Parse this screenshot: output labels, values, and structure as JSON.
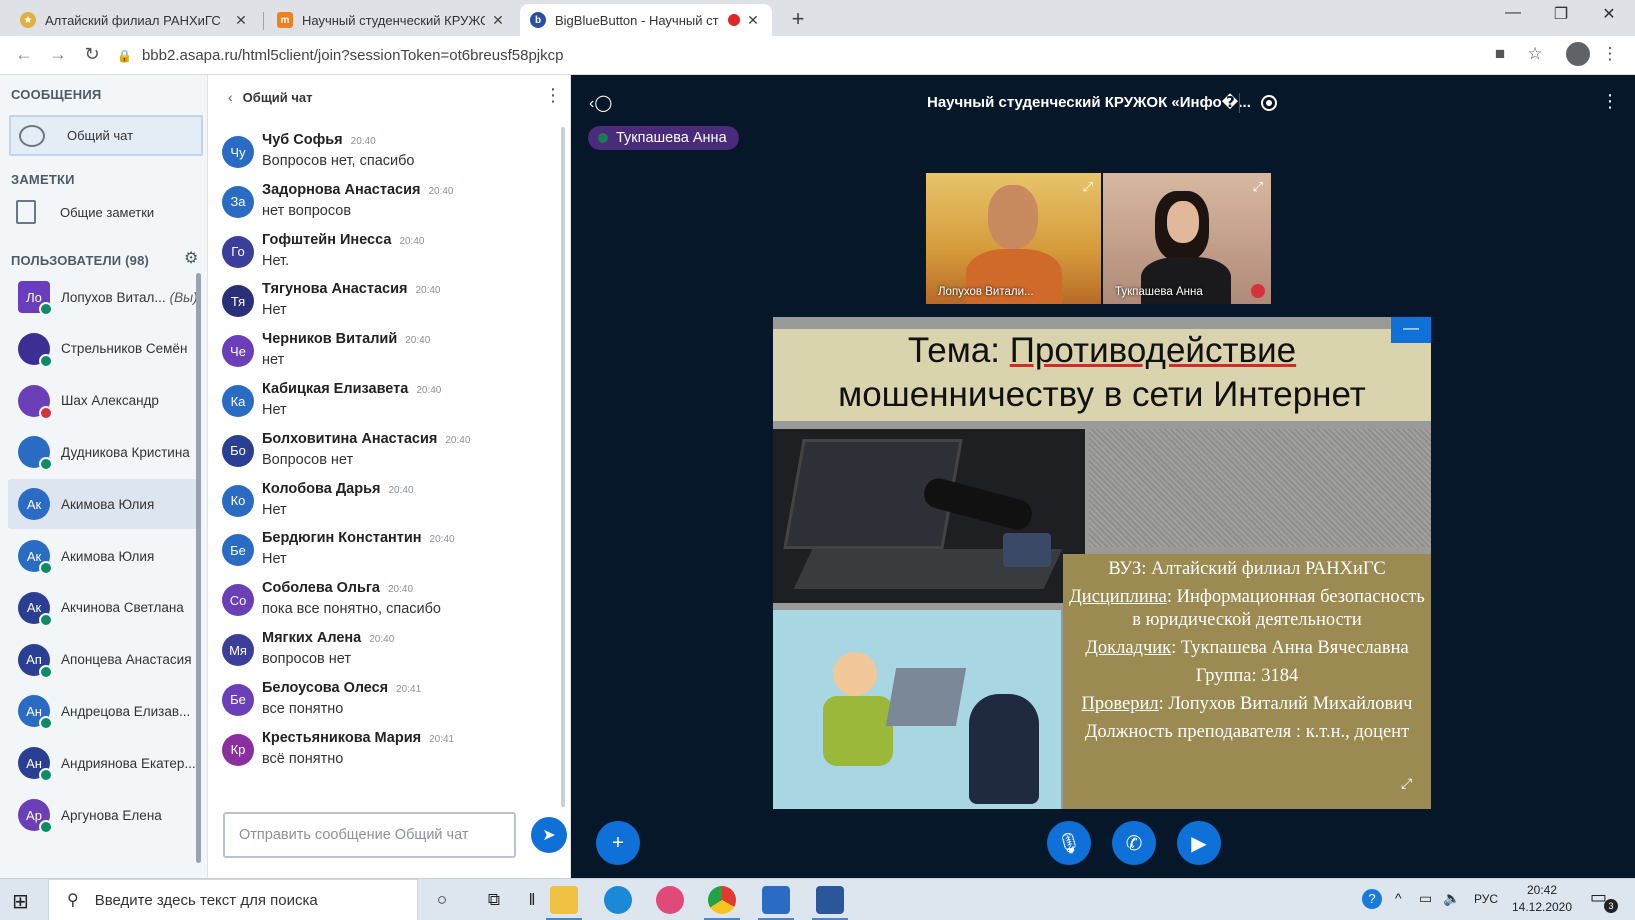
{
  "browser": {
    "tabs": [
      {
        "title": "Алтайский филиал РАНХиГС",
        "favicon": "ranepa-icon"
      },
      {
        "title": "Научный студенческий КРУЖО",
        "favicon": "moodle-icon"
      },
      {
        "title": "BigBlueButton - Научный ст",
        "favicon": "bbb-icon",
        "active": true,
        "recording": true
      }
    ],
    "new_tab": "+",
    "url": "bbb2.asapa.ru/html5client/join?sessionToken=ot6breusf58pjkcp"
  },
  "left": {
    "messages_title": "СООБЩЕНИЯ",
    "public_chat": "Общий чат",
    "notes_title": "ЗАМЕТКИ",
    "shared_notes": "Общие заметки",
    "users_title": "ПОЛЬЗОВАТЕЛИ (98)",
    "users": [
      {
        "initials": "Ло",
        "name": "Лопухов Витал...",
        "you": "(Вы)",
        "color": "#6a3dbe",
        "presenter": true,
        "badge": "mic"
      },
      {
        "initials": "",
        "name": "Стрельников Семён",
        "color": "#3b2f93",
        "badge": "mic"
      },
      {
        "initials": "",
        "name": "Шах Александр",
        "color": "#6b3fb8",
        "badge": "muted"
      },
      {
        "initials": "",
        "name": "Дудникова Кристина",
        "color": "#2a6cc3",
        "badge": "mic"
      },
      {
        "initials": "Ак",
        "name": "Акимова Юлия",
        "color": "#2a6cc3",
        "badge": "none",
        "highlight": true
      },
      {
        "initials": "Ак",
        "name": "Акимова Юлия",
        "color": "#2a6cc3",
        "badge": "mic"
      },
      {
        "initials": "Ак",
        "name": "Акчинова Светлана",
        "color": "#2a3f93",
        "badge": "mic"
      },
      {
        "initials": "Ап",
        "name": "Апонцева Анастасия",
        "color": "#2a3f93",
        "badge": "mic"
      },
      {
        "initials": "Ан",
        "name": "Андрецова Елизав...",
        "color": "#2a6cc3",
        "badge": "mic"
      },
      {
        "initials": "Ан",
        "name": "Андриянова Екатер...",
        "color": "#2a3f93",
        "badge": "mic"
      },
      {
        "initials": "Ар",
        "name": "Аргунова Елена",
        "color": "#6b3fb8",
        "badge": "mic"
      }
    ]
  },
  "chat": {
    "title": "Общий чат",
    "messages": [
      {
        "initials": "Чу",
        "name": "Чуб Софья",
        "time": "20:40",
        "text": "Вопросов нет, спасибо",
        "color": "#2a6cc3"
      },
      {
        "initials": "За",
        "name": "Задорнова Анастасия",
        "time": "20:40",
        "text": "нет вопросов",
        "color": "#2a6cc3"
      },
      {
        "initials": "Го",
        "name": "Гофштейн Инесса",
        "time": "20:40",
        "text": "Нет.",
        "color": "#3b3f9a"
      },
      {
        "initials": "Тя",
        "name": "Тягунова Анастасия",
        "time": "20:40",
        "text": "Нет",
        "color": "#2a2f7a"
      },
      {
        "initials": "Че",
        "name": "Черников Виталий",
        "time": "20:40",
        "text": "нет",
        "color": "#6b3fb8"
      },
      {
        "initials": "Ка",
        "name": "Кабицкая Елизавета",
        "time": "20:40",
        "text": "Нет",
        "color": "#2a6cc3"
      },
      {
        "initials": "Бо",
        "name": "Болховитина Анастасия",
        "time": "20:40",
        "text": "Вопросов нет",
        "color": "#2a3f93"
      },
      {
        "initials": "Ко",
        "name": "Колобова Дарья",
        "time": "20:40",
        "text": "Нет",
        "color": "#2a6cc3"
      },
      {
        "initials": "Бе",
        "name": "Бердюгин Константин",
        "time": "20:40",
        "text": "Нет",
        "color": "#2a6cc3"
      },
      {
        "initials": "Со",
        "name": "Соболева Ольга",
        "time": "20:40",
        "text": "пока все понятно, спасибо",
        "color": "#6b3fb8"
      },
      {
        "initials": "Мя",
        "name": "Мягких Алена",
        "time": "20:40",
        "text": "вопросов нет",
        "color": "#3b3f9a"
      },
      {
        "initials": "Бе",
        "name": "Белоусова Олеся",
        "time": "20:41",
        "text": "все понятно",
        "color": "#6b3fb8"
      },
      {
        "initials": "Кр",
        "name": "Крестьяникова Мария",
        "time": "20:41",
        "text": "всё понятно",
        "color": "#8a2fa0"
      }
    ],
    "input_placeholder": "Отправить сообщение Общий чат"
  },
  "stage": {
    "title": "Научный студенческий КРУЖОК «Инфо�...",
    "talker": "Тукпашева Анна",
    "videos": [
      {
        "name": "Лопухов Витали..."
      },
      {
        "name": "Тукпашева Анна"
      }
    ],
    "slide": {
      "title_prefix": "Тема: ",
      "title_underlined": "Противодействие",
      "title_line2": "мошенничеству в сети Интернет",
      "vuz": "ВУЗ: Алтайский филиал РАНХиГС",
      "discipline_label": "Дисциплина",
      "discipline_value": ": Информационная безопасность в юридической деятельности",
      "speaker_label": "Докладчик",
      "speaker_value": ": Тукпашева Анна Вячеславна",
      "group": "Группа: 3184",
      "checked_label": "Проверил",
      "checked_value": ": Лопухов Виталий Михайлович",
      "position": "Должность преподавателя : к.т.н., доцент"
    }
  },
  "taskbar": {
    "search_placeholder": "Введите здесь текст для поиска",
    "lang": "РУС",
    "time": "20:42",
    "date": "14.12.2020",
    "notifications": "3"
  }
}
